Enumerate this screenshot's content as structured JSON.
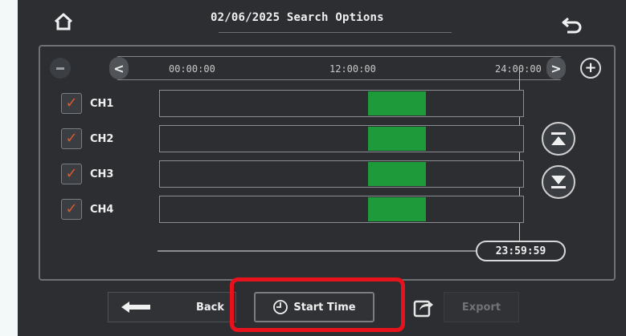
{
  "header": {
    "title": "02/06/2025  Search Options",
    "home_icon": "home-icon",
    "return_icon": "return-arrow-icon"
  },
  "timeline": {
    "ticks": [
      "00:00:00",
      "12:00:00",
      "24:00:00"
    ],
    "current_time": "23:59:59",
    "zoom_out_icon": "minus-icon",
    "zoom_in_icon": "plus-icon"
  },
  "channels": [
    {
      "label": "CH1",
      "checked": true,
      "recording": {
        "start": "13:43",
        "end": "18:28"
      }
    },
    {
      "label": "CH2",
      "checked": true,
      "recording": {
        "start": "13:43",
        "end": "18:28"
      }
    },
    {
      "label": "CH3",
      "checked": true,
      "recording": {
        "start": "13:43",
        "end": "18:28"
      }
    },
    {
      "label": "CH4",
      "checked": true,
      "recording": {
        "start": "13:43",
        "end": "18:28"
      }
    }
  ],
  "buttons": {
    "back": "Back",
    "start_time": "Start Time",
    "export": "Export"
  },
  "colors": {
    "recording": "#1e9a3b",
    "checkmark": "#e0572a",
    "highlight": "#e8121d",
    "background": "#2c2e31"
  }
}
